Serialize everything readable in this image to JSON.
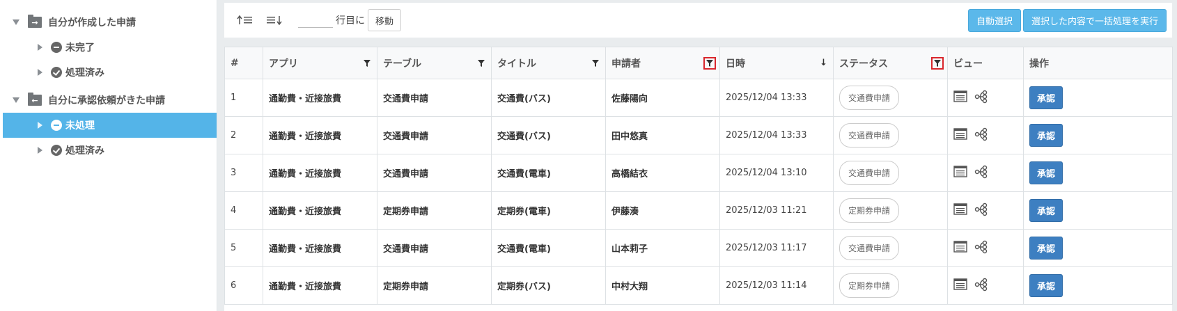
{
  "sidebar": {
    "groups": [
      {
        "label": "自分が作成した申請",
        "children": [
          {
            "label": "未完了"
          },
          {
            "label": "処理済み"
          }
        ]
      },
      {
        "label": "自分に承認依頼がきた申請",
        "children": [
          {
            "label": "未処理"
          },
          {
            "label": "処理済み"
          }
        ]
      }
    ],
    "active_item": "未処理"
  },
  "toolbar": {
    "row_input_value": "",
    "row_label": "行目に",
    "move_label": "移動",
    "auto_select_label": "自動選択",
    "bulk_process_label": "選択した内容で一括処理を実行"
  },
  "table": {
    "headers": {
      "num": "#",
      "app": "アプリ",
      "table": "テーブル",
      "title": "タイトル",
      "applicant": "申請者",
      "datetime": "日時",
      "status": "ステータス",
      "view": "ビュー",
      "action": "操作"
    },
    "rows": [
      {
        "num": "1",
        "app": "通勤費・近接旅費",
        "table": "交通費申請",
        "title": "交通費(バス)",
        "applicant": "佐藤陽向",
        "datetime": "2025/12/04 13:33",
        "status": "交通費申請",
        "action": "承認"
      },
      {
        "num": "2",
        "app": "通勤費・近接旅費",
        "table": "交通費申請",
        "title": "交通費(バス)",
        "applicant": "田中悠真",
        "datetime": "2025/12/04 13:33",
        "status": "交通費申請",
        "action": "承認"
      },
      {
        "num": "3",
        "app": "通勤費・近接旅費",
        "table": "交通費申請",
        "title": "交通費(電車)",
        "applicant": "高橋結衣",
        "datetime": "2025/12/04 13:10",
        "status": "交通費申請",
        "action": "承認"
      },
      {
        "num": "4",
        "app": "通勤費・近接旅費",
        "table": "定期券申請",
        "title": "定期券(電車)",
        "applicant": "伊藤湊",
        "datetime": "2025/12/03 11:21",
        "status": "定期券申請",
        "action": "承認"
      },
      {
        "num": "5",
        "app": "通勤費・近接旅費",
        "table": "交通費申請",
        "title": "交通費(電車)",
        "applicant": "山本莉子",
        "datetime": "2025/12/03 11:17",
        "status": "交通費申請",
        "action": "承認"
      },
      {
        "num": "6",
        "app": "通勤費・近接旅費",
        "table": "定期券申請",
        "title": "定期券(バス)",
        "applicant": "中村大翔",
        "datetime": "2025/12/03 11:14",
        "status": "定期券申請",
        "action": "承認"
      }
    ]
  },
  "colors": {
    "active": "#54b4e8",
    "primary_button": "#5bb8ea",
    "approve_button": "#3d7fc1",
    "filter_highlight": "#d9262c"
  }
}
